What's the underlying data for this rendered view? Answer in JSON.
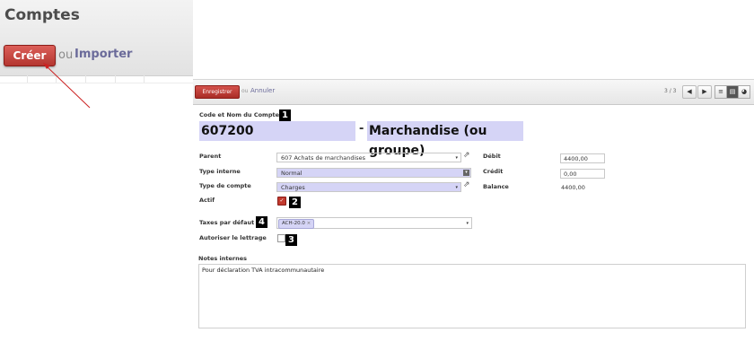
{
  "header": {
    "title": "Comptes",
    "create_label": "Créer",
    "or_label": "ou",
    "import_label": "Importer"
  },
  "toolbar": {
    "save_label": "Enregistrer",
    "or_label": "ou",
    "cancel_label": "Annuler",
    "pager": "3 / 3"
  },
  "form": {
    "code_name_label": "Code et Nom du Compte",
    "code": "607200",
    "dash": "-",
    "name": "Marchandise (ou groupe)",
    "parent_label": "Parent",
    "parent_value": "607 Achats de marchandises",
    "type_interne_label": "Type interne",
    "type_interne_value": "Normal",
    "type_compte_label": "Type de compte",
    "type_compte_value": "Charges",
    "actif_label": "Actif",
    "actif_checked": true,
    "taxes_label": "Taxes par défaut",
    "tax_tag": "ACH-20.0",
    "tax_tag_remove": "×",
    "lettrage_label": "Autoriser le lettrage",
    "lettrage_checked": false,
    "debit_label": "Débit",
    "debit_value": "4400,00",
    "credit_label": "Crédit",
    "credit_value": "0,00",
    "balance_label": "Balance",
    "balance_value": "4400,00",
    "notes_label": "Notes internes",
    "notes_value": "Pour déclaration TVA intracommunautaire"
  },
  "badges": {
    "b1": "1",
    "b2": "2",
    "b3": "3",
    "b4": "4"
  },
  "icons": {
    "caret": "▾",
    "external_link": "⇗",
    "nav_prev": "◀",
    "nav_next": "▶",
    "view_list": "≡",
    "view_form": "▤",
    "view_graph": "◕"
  },
  "colors": {
    "create_button": "#c9302c",
    "highlight": "#d5d4f6",
    "arrow": "#cc2222"
  }
}
